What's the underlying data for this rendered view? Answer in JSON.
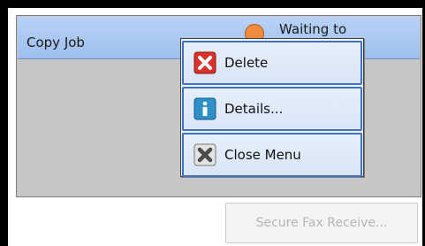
{
  "job_list": {
    "job_name": "Copy Job",
    "status_text": "Waiting to",
    "status_icon": "waiting-status-icon"
  },
  "menu": {
    "items": [
      {
        "label": "Delete",
        "icon": "delete-icon"
      },
      {
        "label": "Details...",
        "icon": "info-icon"
      },
      {
        "label": "Close Menu",
        "icon": "close-icon"
      }
    ]
  },
  "footer": {
    "secure_fax_label": "Secure Fax Receive..."
  },
  "colors": {
    "selected_row": "#a9c7f1",
    "menu_border": "#3b72c7",
    "delete_icon": "#d9322a",
    "info_icon": "#2f8fc8",
    "status_icon": "#ee8a3d"
  }
}
